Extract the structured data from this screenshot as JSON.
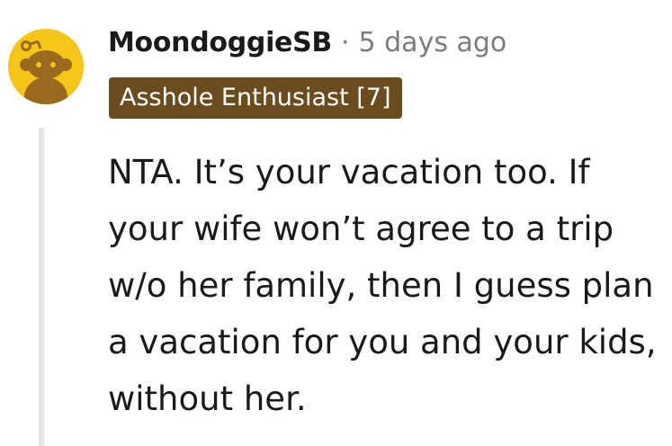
{
  "comment": {
    "username": "MoondoggieSB",
    "separator": "·",
    "timestamp": "5 days ago",
    "flair": "Asshole Enthusiast [7]",
    "body": "NTA. It’s your vacation too. If your wife won’t agree to a trip w/o her family, then I guess plan a vacation for you and your kids, without her."
  },
  "colors": {
    "avatar_background": "#f5c518",
    "avatar_figure": "#9a6b1f",
    "flair_background": "#6b4c1e",
    "flair_text": "#ffffff",
    "username": "#1a1a1b",
    "meta_text": "#7c7c7c",
    "thread_line": "#e6e6e6"
  },
  "icons": {
    "avatar": "snoo-avatar-icon"
  }
}
